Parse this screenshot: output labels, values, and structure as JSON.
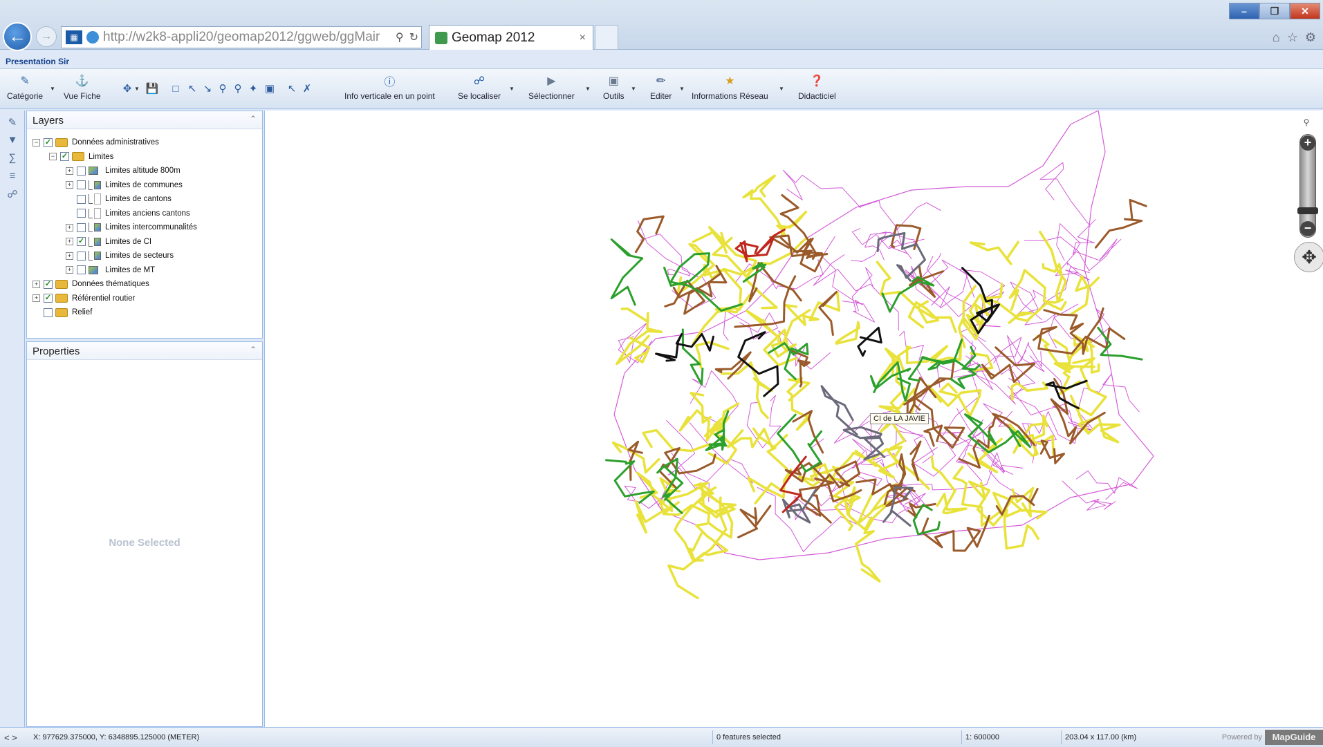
{
  "browser": {
    "url": "http://w2k8-appli20/geomap2012/ggweb/ggMair",
    "url_host": "w2k8-appli20",
    "tab_title": "Geomap 2012"
  },
  "app": {
    "title": "Presentation Sir"
  },
  "toolbar": {
    "categorie": "Catégorie",
    "vue_fiche": "Vue Fiche",
    "info_verticale": "Info verticale en un point",
    "se_localiser": "Se localiser",
    "selectionner": "Sélectionner",
    "outils": "Outils",
    "editer": "Editer",
    "informations_reseau": "Informations Réseau",
    "didacticiel": "Didacticiel"
  },
  "layers_panel": {
    "title": "Layers",
    "items": [
      {
        "label": "Données administratives",
        "checked": true
      },
      {
        "label": "Limites",
        "checked": true
      },
      {
        "label": "Limites altitude 800m",
        "checked": false
      },
      {
        "label": "Limites de communes",
        "checked": false
      },
      {
        "label": "Limites de cantons",
        "checked": false
      },
      {
        "label": "Limites anciens cantons",
        "checked": false
      },
      {
        "label": "Limites intercommunalités",
        "checked": false
      },
      {
        "label": "Limites de CI",
        "checked": true
      },
      {
        "label": "Limites de secteurs",
        "checked": false
      },
      {
        "label": "Limites de MT",
        "checked": false
      },
      {
        "label": "Données thématiques",
        "checked": true
      },
      {
        "label": "Référentiel routier",
        "checked": true
      },
      {
        "label": "Relief",
        "checked": false
      }
    ]
  },
  "properties_panel": {
    "title": "Properties",
    "empty_text": "None Selected"
  },
  "map": {
    "tooltip": "CI de LA JAVIE"
  },
  "status": {
    "coords": "X: 977629.375000, Y: 6348895.125000 (METER)",
    "selection": "0 features selected",
    "scale": "1: 600000",
    "extent": "203.04 x 117.00 (km)",
    "powered_by": "Powered by",
    "logo": "MapGuide"
  },
  "colors": {
    "boundary": "#d45ad8",
    "road_yellow": "#e8e23a",
    "road_brown": "#9a5a2a",
    "road_green": "#2ca02c",
    "road_black": "#111111",
    "road_grey": "#6a6a7a",
    "road_red": "#c0281e"
  }
}
